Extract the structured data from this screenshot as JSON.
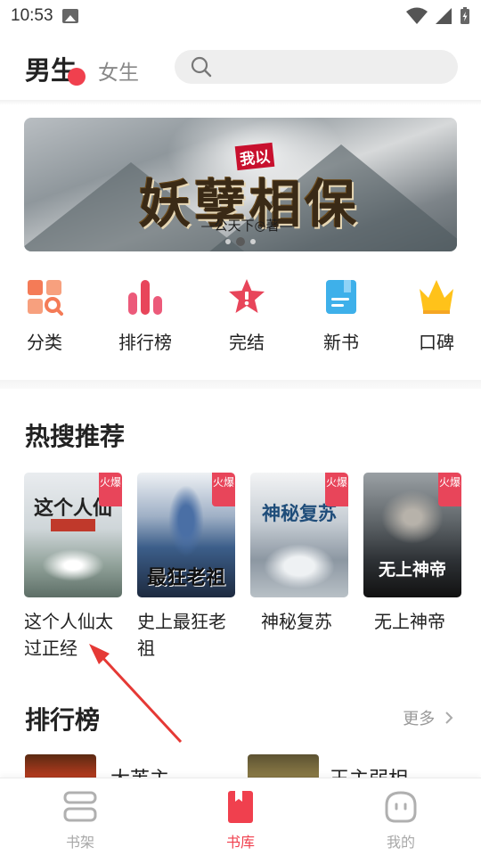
{
  "status_bar": {
    "time": "10:53"
  },
  "header": {
    "tab_male": "男生",
    "tab_female": "女生",
    "search_placeholder": ""
  },
  "banner": {
    "badge": "我以",
    "title": "妖孽相保",
    "author": "—公天下◎著—"
  },
  "quick_nav": [
    {
      "label": "分类",
      "icon": "category-icon"
    },
    {
      "label": "排行榜",
      "icon": "ranking-bars-icon"
    },
    {
      "label": "完结",
      "icon": "finished-star-icon"
    },
    {
      "label": "新书",
      "icon": "new-book-icon"
    },
    {
      "label": "口碑",
      "icon": "crown-icon"
    }
  ],
  "hot_search": {
    "title": "热搜推荐",
    "books": [
      {
        "name": "这个人仙太过正经",
        "tag": "火爆",
        "cover_text": "这个人仙"
      },
      {
        "name": "史上最狂老祖",
        "tag": "火爆",
        "cover_text": "最狂老祖"
      },
      {
        "name": "神秘复苏",
        "tag": "火爆",
        "cover_text": "神秘复苏"
      },
      {
        "name": "无上神帝",
        "tag": "火爆",
        "cover_text": "无上神帝"
      }
    ]
  },
  "ranking": {
    "title": "排行榜",
    "more": "更多",
    "items": [
      {
        "name": "大芙主"
      },
      {
        "name": "王主弱相"
      }
    ]
  },
  "bottom_nav": [
    {
      "label": "书架",
      "icon": "bookshelf-icon",
      "active": false
    },
    {
      "label": "书库",
      "icon": "library-book-icon",
      "active": true
    },
    {
      "label": "我的",
      "icon": "profile-face-icon",
      "active": false
    }
  ],
  "colors": {
    "accent": "#f0404e",
    "text": "#222222",
    "muted": "#999999"
  }
}
